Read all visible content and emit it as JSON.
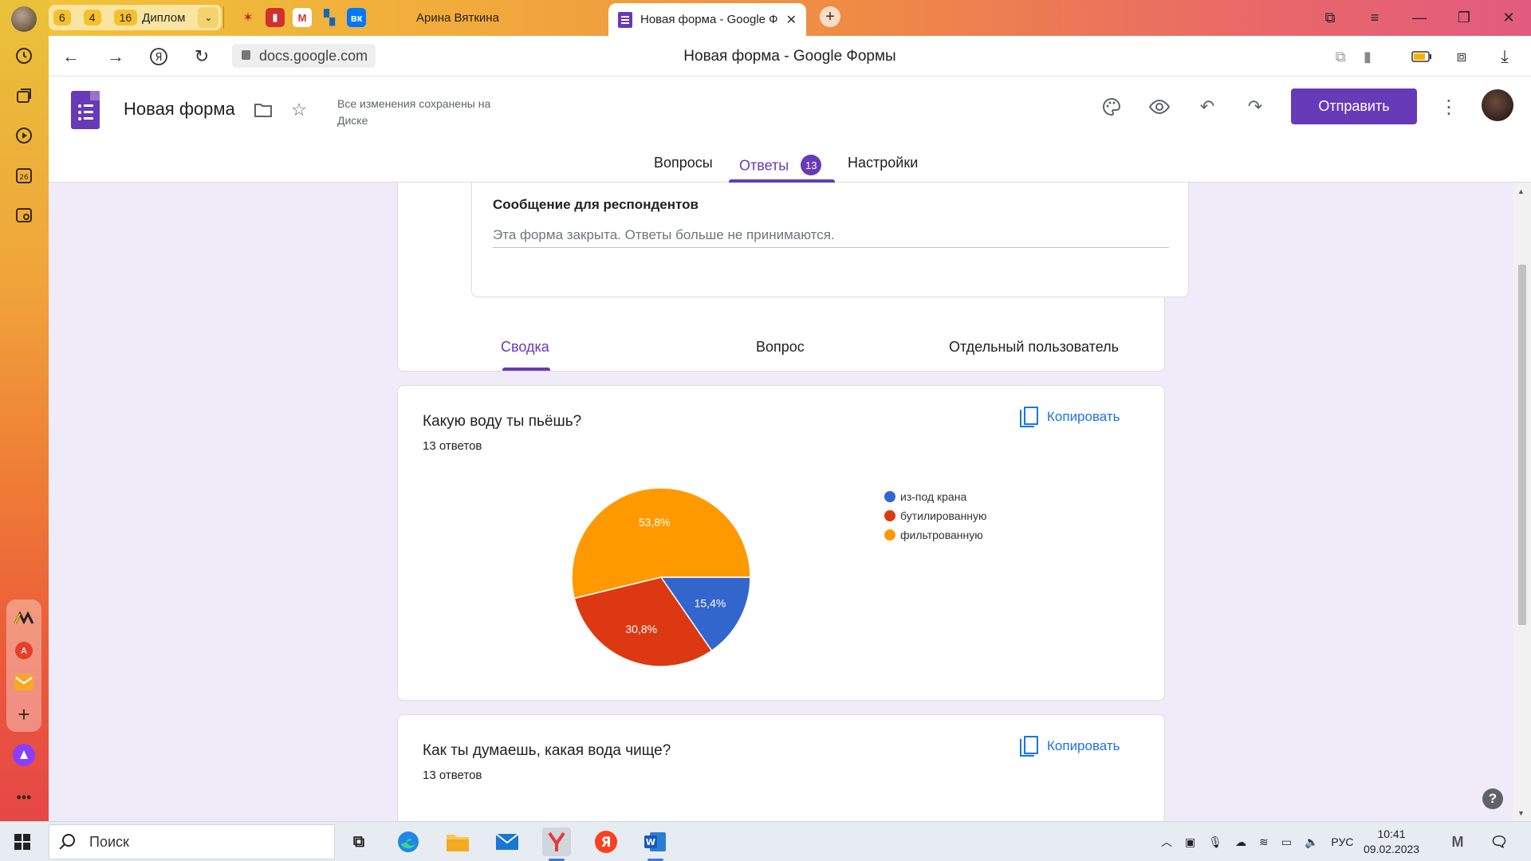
{
  "browser": {
    "tab_groups": [
      {
        "count": "6",
        "label": ""
      },
      {
        "count": "4",
        "label": ""
      },
      {
        "count": "16",
        "label": "Диплом"
      }
    ],
    "tabs": [
      {
        "label": "Арина Вяткина"
      },
      {
        "label": "Новая форма - Google Формы"
      }
    ],
    "url": "docs.google.com",
    "page_title": "Новая форма - Google Формы"
  },
  "form": {
    "title": "Новая форма",
    "save_status": "Все изменения сохранены на Диске",
    "send_label": "Отправить",
    "tabs": [
      {
        "label": "Вопросы"
      },
      {
        "label": "Ответы",
        "badge": "13"
      },
      {
        "label": "Настройки"
      }
    ],
    "active_tab": "Ответы"
  },
  "closed_message": {
    "label": "Сообщение для респондентов",
    "text": "Эта форма закрыта. Ответы больше не принимаются."
  },
  "summary_tabs": [
    {
      "label": "Сводка"
    },
    {
      "label": "Вопрос"
    },
    {
      "label": "Отдельный пользователь"
    }
  ],
  "questions": [
    {
      "title": "Какую воду ты пьёшь?",
      "count": "13 ответов",
      "copy_label": "Копировать"
    },
    {
      "title": "Как ты думаешь, какая вода чище?",
      "count": "13 ответов",
      "copy_label": "Копировать"
    }
  ],
  "chart_data": {
    "type": "pie",
    "series": [
      {
        "name": "из-под крана",
        "value": 15.4,
        "label": "15,4%",
        "color": "#3366cc"
      },
      {
        "name": "бутилированную",
        "value": 30.8,
        "label": "30,8%",
        "color": "#dc3912"
      },
      {
        "name": "фильтрованную",
        "value": 53.8,
        "label": "53,8%",
        "color": "#ff9900"
      }
    ],
    "legend_position": "right"
  },
  "taskbar": {
    "search_placeholder": "Поиск",
    "lang": "РУС",
    "time": "10:41",
    "date": "09.02.2023"
  }
}
